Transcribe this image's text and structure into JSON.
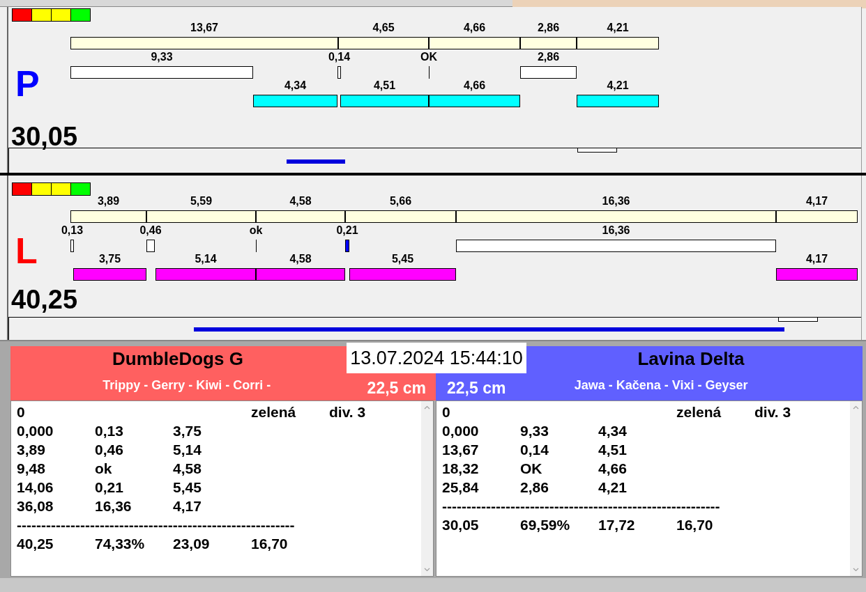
{
  "lanes": [
    {
      "letter": "P",
      "color": "#0000ff",
      "signal": [
        {
          "color": "#ff0000"
        },
        {
          "color": "#ffff00"
        },
        {
          "color": "#ffff00"
        },
        {
          "color": "#00ff00"
        }
      ],
      "total": "30,05",
      "rows": [
        {
          "segments": [
            {
              "kind": "bar",
              "label": "13,67",
              "color": "#ffffe0"
            },
            {
              "kind": "bar",
              "label": "4,65",
              "color": "#ffffe0"
            },
            {
              "kind": "bar",
              "label": "4,66",
              "color": "#ffffe0"
            },
            {
              "kind": "bar",
              "label": "2,86",
              "color": "#ffffe0"
            },
            {
              "kind": "bar",
              "label": "4,21",
              "color": "#ffffe0"
            }
          ]
        },
        {
          "segments": [
            {
              "kind": "bar",
              "label": "9,33",
              "color": "#ffffff"
            },
            {
              "kind": "bar",
              "label": "0,14",
              "color": "#ffffff"
            },
            {
              "kind": "line",
              "label": "OK",
              "color": "#000000"
            },
            {
              "kind": "bar",
              "label": "2,86",
              "color": "#ffffff"
            }
          ]
        },
        {
          "segments": [
            {
              "kind": "bar",
              "label": "4,34",
              "color": "#00ffff"
            },
            {
              "kind": "bar",
              "label": "4,51",
              "color": "#00ffff"
            },
            {
              "kind": "bar",
              "label": "4,66",
              "color": "#00ffff"
            },
            {
              "kind": "bar",
              "label": "4,21",
              "color": "#00ffff"
            }
          ]
        }
      ]
    },
    {
      "letter": "L",
      "color": "#ff0000",
      "signal": [
        {
          "color": "#ff0000"
        },
        {
          "color": "#ffff00"
        },
        {
          "color": "#ffff00"
        },
        {
          "color": "#00ff00"
        }
      ],
      "total": "40,25",
      "rows": [
        {
          "segments": [
            {
              "kind": "bar",
              "label": "3,89",
              "color": "#ffffe0"
            },
            {
              "kind": "bar",
              "label": "5,59",
              "color": "#ffffe0"
            },
            {
              "kind": "bar",
              "label": "4,58",
              "color": "#ffffe0"
            },
            {
              "kind": "bar",
              "label": "5,66",
              "color": "#ffffe0"
            },
            {
              "kind": "bar",
              "label": "16,36",
              "color": "#ffffe0"
            },
            {
              "kind": "bar",
              "label": "4,17",
              "color": "#ffffe0"
            }
          ]
        },
        {
          "segments": [
            {
              "kind": "bar",
              "label": "0,13",
              "color": "#ffffff"
            },
            {
              "kind": "bar",
              "label": "0,46",
              "color": "#ffffff"
            },
            {
              "kind": "line",
              "label": "ok",
              "color": "#000000"
            },
            {
              "kind": "bar",
              "label": "0,21",
              "color": "#0000ff"
            },
            {
              "kind": "bar",
              "label": "16,36",
              "color": "#ffffff"
            }
          ]
        },
        {
          "segments": [
            {
              "kind": "bar",
              "label": "3,75",
              "color": "#ff00ff"
            },
            {
              "kind": "bar",
              "label": "5,14",
              "color": "#ff00ff"
            },
            {
              "kind": "bar",
              "label": "4,58",
              "color": "#ff00ff"
            },
            {
              "kind": "bar",
              "label": "5,45",
              "color": "#ff00ff"
            },
            {
              "kind": "bar",
              "label": "4,17",
              "color": "#ff00ff"
            }
          ]
        }
      ]
    }
  ],
  "datetime": "13.07.2024 15:44:10",
  "teams": [
    {
      "name": "DumbleDogs G",
      "members": "Trippy - Gerry - Kiwi - Corri -",
      "height": "22,5 cm",
      "color": "#ff6060",
      "log": {
        "header": {
          "number": "0",
          "color_name": "zelená",
          "division": "div. 3"
        },
        "rows": [
          [
            "0,000",
            "0,13",
            "3,75"
          ],
          [
            "3,89",
            "0,46",
            "5,14"
          ],
          [
            "9,48",
            "ok",
            "4,58"
          ],
          [
            "14,06",
            "0,21",
            "5,45"
          ],
          [
            "36,08",
            "16,36",
            "4,17"
          ]
        ],
        "separator": "---------------------------------------------------------",
        "totals": [
          "40,25",
          "74,33%",
          "23,09",
          "16,70"
        ]
      }
    },
    {
      "name": "Lavina Delta",
      "members": "Jawa - Kačena - Vixi - Geyser",
      "height": "22,5 cm",
      "color": "#6060ff",
      "log": {
        "header": {
          "number": "0",
          "color_name": "zelená",
          "division": "div. 3"
        },
        "rows": [
          [
            "0,000",
            "9,33",
            "4,34"
          ],
          [
            "13,67",
            "0,14",
            "4,51"
          ],
          [
            "18,32",
            "OK",
            "4,66"
          ],
          [
            "25,84",
            "2,86",
            "4,21"
          ]
        ],
        "separator": "---------------------------------------------------------",
        "totals": [
          "30,05",
          "69,59%",
          "17,72",
          "16,70"
        ]
      }
    }
  ]
}
